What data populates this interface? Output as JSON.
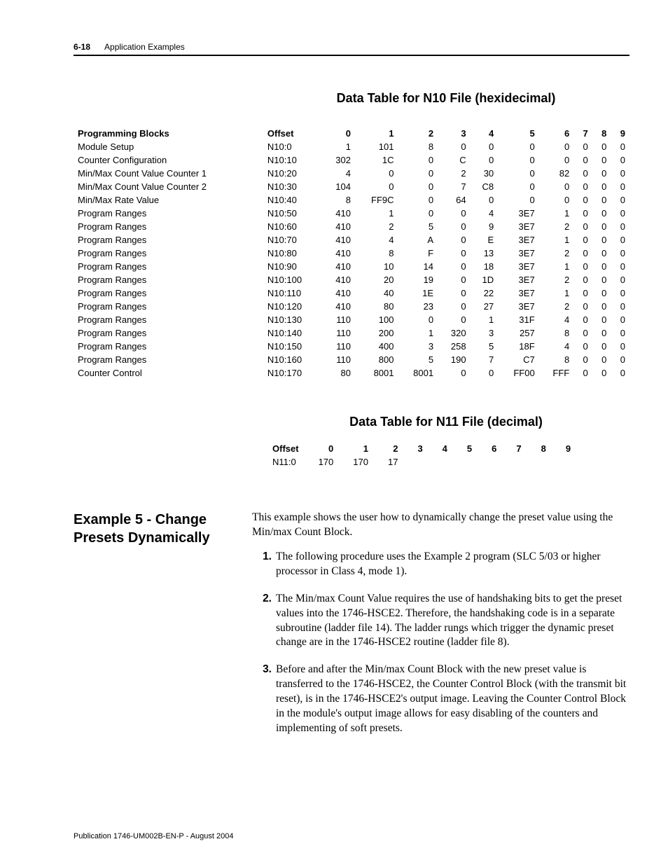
{
  "header": {
    "page_num": "6-18",
    "chapter": "Application Examples"
  },
  "table1": {
    "title": "Data Table for N10 File (hexidecimal)",
    "head": [
      "Programming Blocks",
      "Offset",
      "0",
      "1",
      "2",
      "3",
      "4",
      "5",
      "6",
      "7",
      "8",
      "9"
    ],
    "rows": [
      [
        "Module Setup",
        "N10:0",
        "1",
        "101",
        "8",
        "0",
        "0",
        "0",
        "0",
        "0",
        "0",
        "0"
      ],
      [
        "Counter Configuration",
        "N10:10",
        "302",
        "1C",
        "0",
        "C",
        "0",
        "0",
        "0",
        "0",
        "0",
        "0"
      ],
      [
        "Min/Max Count Value Counter 1",
        "N10:20",
        "4",
        "0",
        "0",
        "2",
        "30",
        "0",
        "82",
        "0",
        "0",
        "0"
      ],
      [
        "Min/Max Count Value Counter 2",
        "N10:30",
        "104",
        "0",
        "0",
        "7",
        "C8",
        "0",
        "0",
        "0",
        "0",
        "0"
      ],
      [
        "Min/Max Rate Value",
        "N10:40",
        "8",
        "FF9C",
        "0",
        "64",
        "0",
        "0",
        "0",
        "0",
        "0",
        "0"
      ],
      [
        "Program Ranges",
        "N10:50",
        "410",
        "1",
        "0",
        "0",
        "4",
        "3E7",
        "1",
        "0",
        "0",
        "0"
      ],
      [
        "Program Ranges",
        "N10:60",
        "410",
        "2",
        "5",
        "0",
        "9",
        "3E7",
        "2",
        "0",
        "0",
        "0"
      ],
      [
        "Program Ranges",
        "N10:70",
        "410",
        "4",
        "A",
        "0",
        "E",
        "3E7",
        "1",
        "0",
        "0",
        "0"
      ],
      [
        "Program Ranges",
        "N10:80",
        "410",
        "8",
        "F",
        "0",
        "13",
        "3E7",
        "2",
        "0",
        "0",
        "0"
      ],
      [
        "Program Ranges",
        "N10:90",
        "410",
        "10",
        "14",
        "0",
        "18",
        "3E7",
        "1",
        "0",
        "0",
        "0"
      ],
      [
        "Program Ranges",
        "N10:100",
        "410",
        "20",
        "19",
        "0",
        "1D",
        "3E7",
        "2",
        "0",
        "0",
        "0"
      ],
      [
        "Program Ranges",
        "N10:110",
        "410",
        "40",
        "1E",
        "0",
        "22",
        "3E7",
        "1",
        "0",
        "0",
        "0"
      ],
      [
        "Program Ranges",
        "N10:120",
        "410",
        "80",
        "23",
        "0",
        "27",
        "3E7",
        "2",
        "0",
        "0",
        "0"
      ],
      [
        "Program Ranges",
        "N10:130",
        "110",
        "100",
        "0",
        "0",
        "1",
        "31F",
        "4",
        "0",
        "0",
        "0"
      ],
      [
        "Program Ranges",
        "N10:140",
        "110",
        "200",
        "1",
        "320",
        "3",
        "257",
        "8",
        "0",
        "0",
        "0"
      ],
      [
        "Program Ranges",
        "N10:150",
        "110",
        "400",
        "3",
        "258",
        "5",
        "18F",
        "4",
        "0",
        "0",
        "0"
      ],
      [
        "Program Ranges",
        "N10:160",
        "110",
        "800",
        "5",
        "190",
        "7",
        "C7",
        "8",
        "0",
        "0",
        "0"
      ],
      [
        "Counter Control",
        "N10:170",
        "80",
        "8001",
        "8001",
        "0",
        "0",
        "FF00",
        "FFF",
        "0",
        "0",
        "0"
      ]
    ]
  },
  "table2": {
    "title": "Data Table for N11 File (decimal)",
    "head": [
      "Offset",
      "0",
      "1",
      "2",
      "3",
      "4",
      "5",
      "6",
      "7",
      "8",
      "9"
    ],
    "rows": [
      [
        "N11:0",
        "170",
        "170",
        "17",
        "",
        "",
        "",
        "",
        "",
        "",
        ""
      ]
    ]
  },
  "example": {
    "heading": "Example 5 - Change Presets Dynamically",
    "intro": "This example shows the user how to dynamically change the preset value using the Min/max Count Block.",
    "steps": [
      "The following procedure uses the Example 2 program (SLC 5/03 or higher processor in Class 4, mode 1).",
      "The Min/max Count Value requires the use of handshaking bits to get the preset values into the 1746-HSCE2. Therefore, the handshaking code is in a separate subroutine (ladder file 14). The ladder rungs which trigger the dynamic preset change are in the 1746-HSCE2 routine (ladder file 8).",
      "Before and after the Min/max Count Block with the new preset value is transferred to the 1746-HSCE2, the Counter Control Block (with the transmit bit reset), is in the 1746-HSCE2's output image. Leaving the Counter Control Block in the module's output image allows for easy disabling of the counters and implementing of soft presets."
    ]
  },
  "footer": "Publication 1746-UM002B-EN-P - August 2004"
}
